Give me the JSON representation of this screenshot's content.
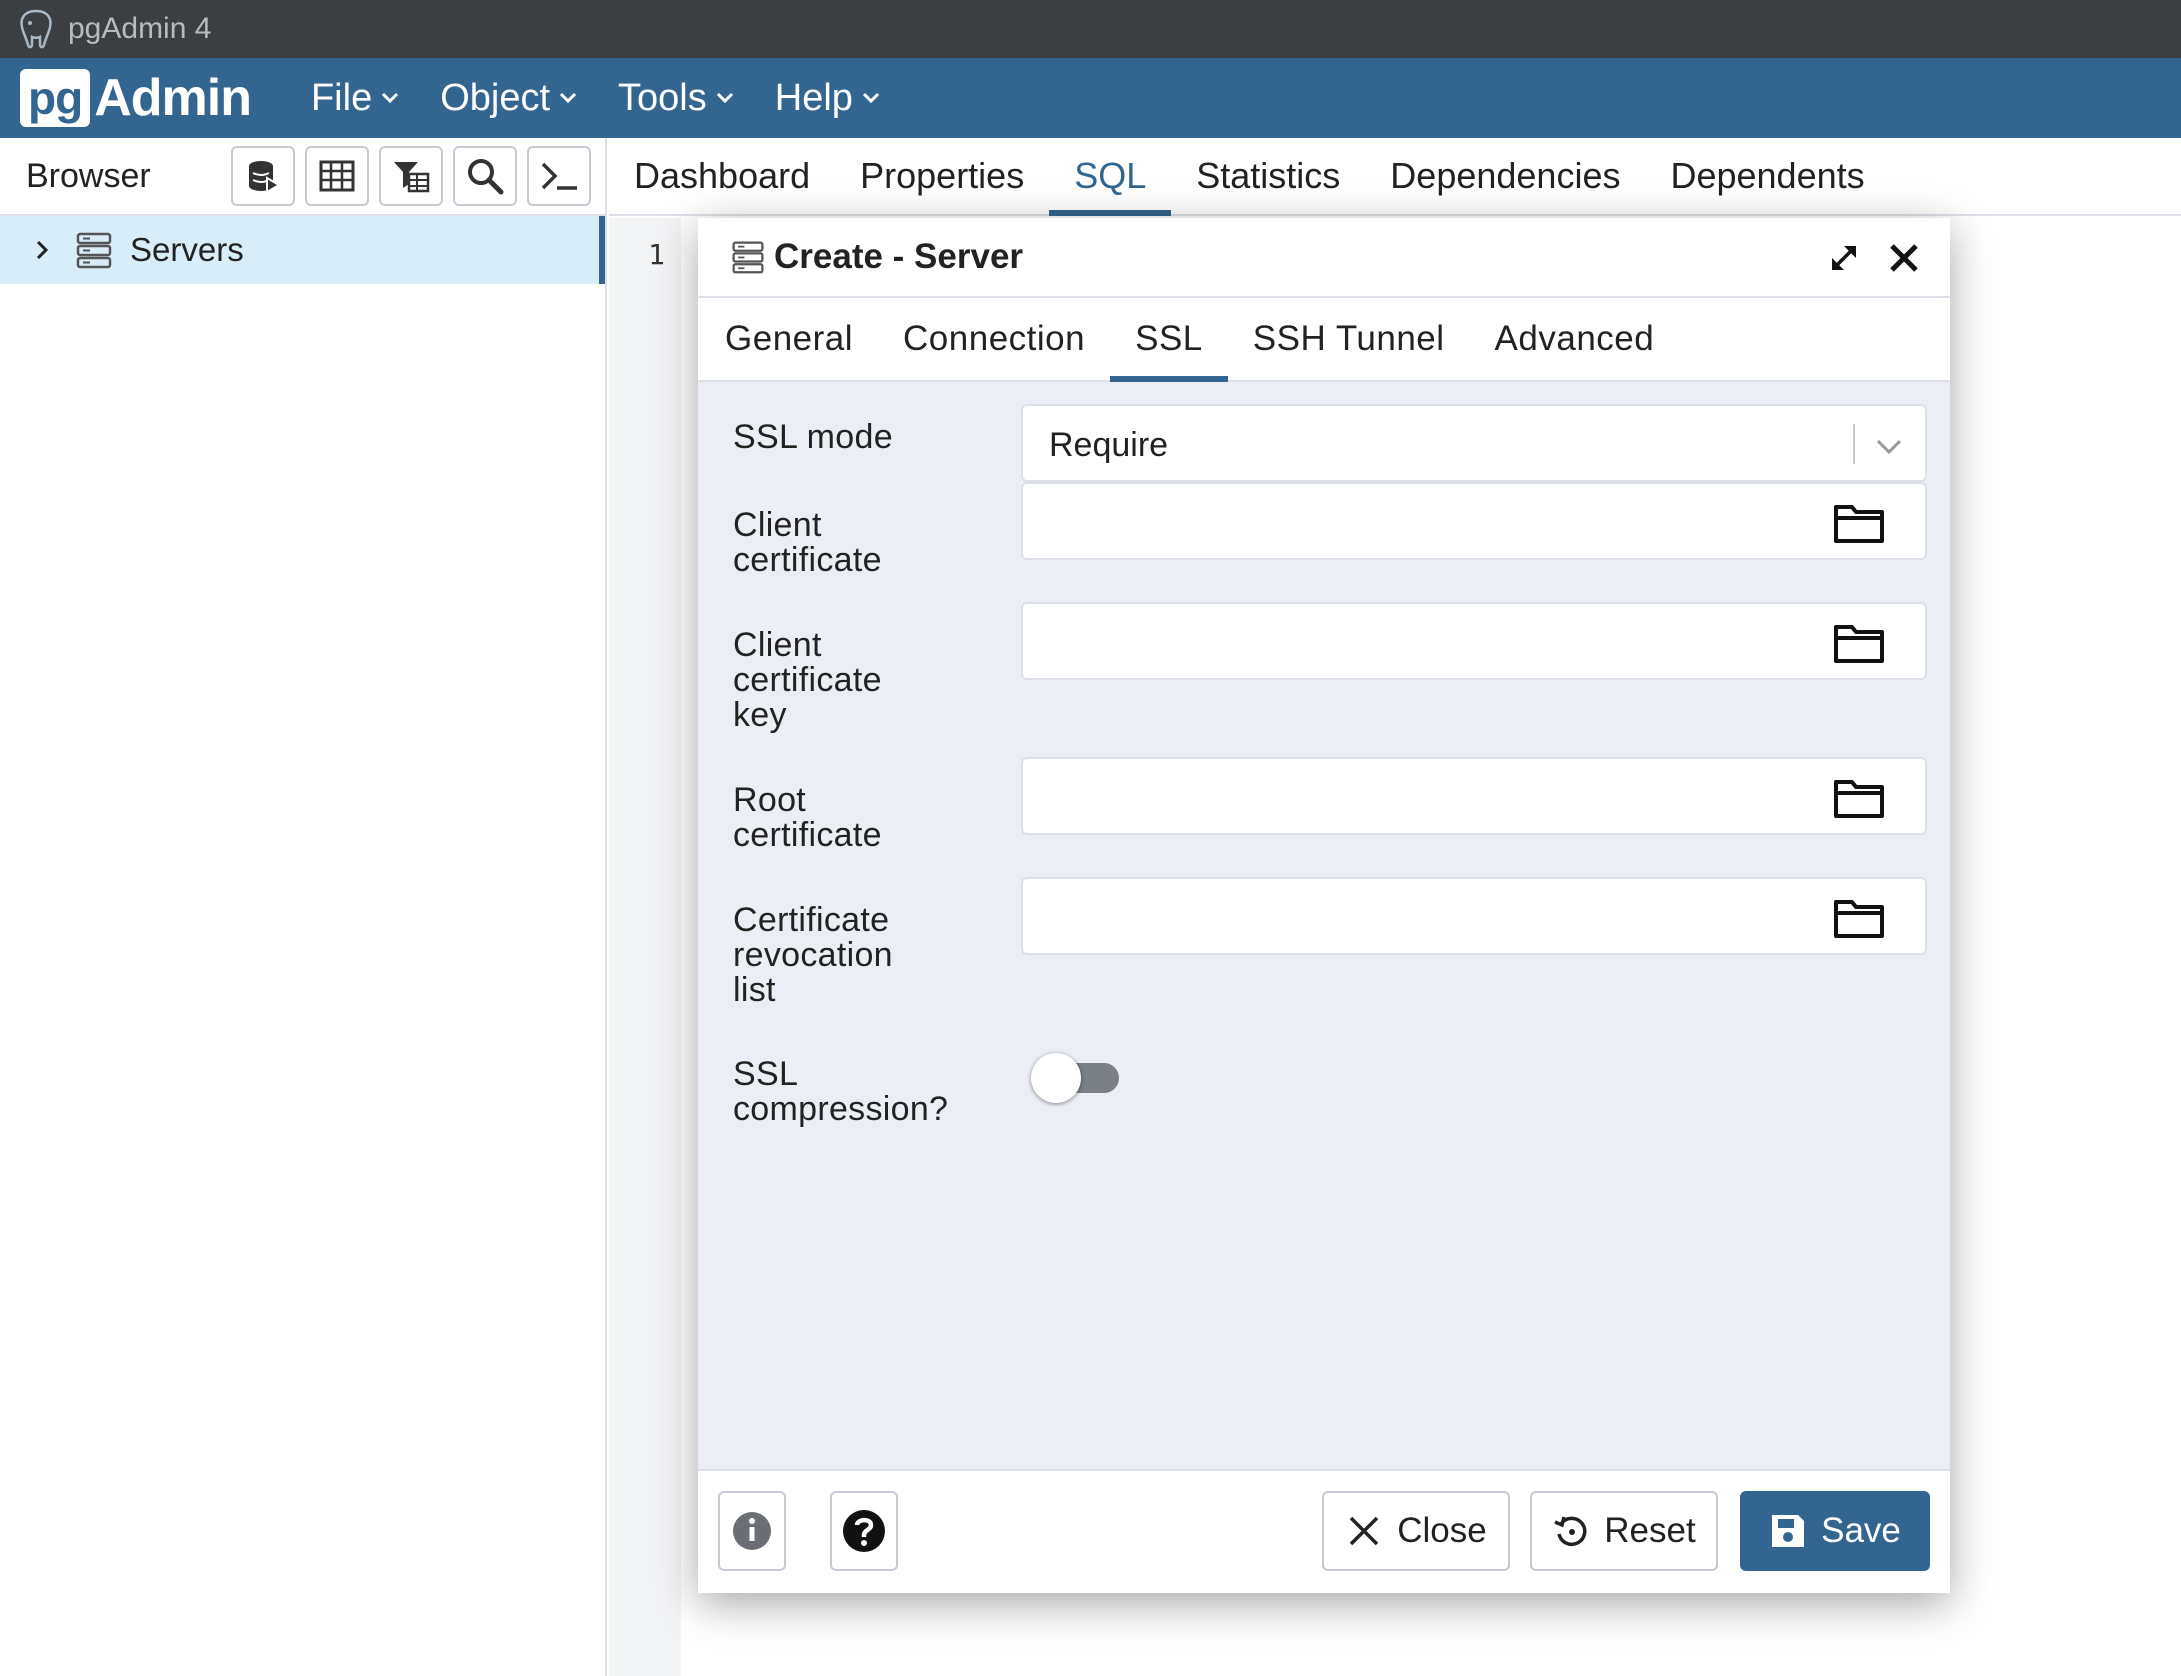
{
  "window": {
    "title": "pgAdmin 4"
  },
  "logo": {
    "pg": "pg",
    "admin": "Admin"
  },
  "menu": [
    {
      "label": "File"
    },
    {
      "label": "Object"
    },
    {
      "label": "Tools"
    },
    {
      "label": "Help"
    }
  ],
  "browser": {
    "title": "Browser",
    "toolbar_icons": [
      "query-tool-icon",
      "view-data-icon",
      "filtered-rows-icon",
      "search-objects-icon",
      "psql-tool-icon"
    ],
    "tree": [
      {
        "label": "Servers",
        "expanded": false,
        "selected": true
      }
    ]
  },
  "main_tabs": [
    {
      "label": "Dashboard",
      "active": false
    },
    {
      "label": "Properties",
      "active": false
    },
    {
      "label": "SQL",
      "active": true
    },
    {
      "label": "Statistics",
      "active": false
    },
    {
      "label": "Dependencies",
      "active": false
    },
    {
      "label": "Dependents",
      "active": false
    }
  ],
  "editor": {
    "line_number": "1"
  },
  "dialog": {
    "title": "Create - Server",
    "tabs": [
      {
        "label": "General",
        "active": false
      },
      {
        "label": "Connection",
        "active": false
      },
      {
        "label": "SSL",
        "active": true
      },
      {
        "label": "SSH Tunnel",
        "active": false
      },
      {
        "label": "Advanced",
        "active": false
      }
    ],
    "fields": {
      "ssl_mode": {
        "label": "SSL mode",
        "value": "Require"
      },
      "client_certificate": {
        "label_lines": [
          "Client",
          "certificate"
        ],
        "value": ""
      },
      "client_certificate_key": {
        "label_lines": [
          "Client",
          "certificate",
          "key"
        ],
        "value": ""
      },
      "root_certificate": {
        "label_lines": [
          "Root",
          "certificate"
        ],
        "value": ""
      },
      "crl": {
        "label_lines": [
          "Certificate",
          "revocation",
          "list"
        ],
        "value": ""
      },
      "ssl_compression": {
        "label_lines": [
          "SSL",
          "compression?"
        ],
        "enabled": false
      }
    },
    "footer": {
      "close_label": "Close",
      "reset_label": "Reset",
      "save_label": "Save"
    }
  },
  "colors": {
    "brand": "#326690",
    "titlebar": "#3b3f42",
    "dialog_body": "#ebeff5",
    "selected_row": "#d9edf8"
  }
}
